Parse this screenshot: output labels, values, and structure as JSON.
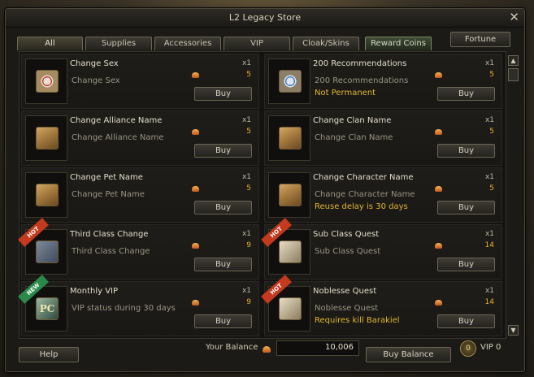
{
  "window": {
    "title": "L2 Legacy Store",
    "close_icon": "close-icon"
  },
  "tabs": [
    {
      "label": "All",
      "active": true
    },
    {
      "label": "Supplies"
    },
    {
      "label": "Accessories"
    },
    {
      "label": "VIP"
    },
    {
      "label": "Cloak/Skins"
    },
    {
      "label": "Reward Coins"
    }
  ],
  "fortune_label": "Fortune",
  "items": [
    {
      "name": "Change Sex",
      "qty": "x1",
      "desc": "Change Sex",
      "price": "5",
      "buy": "Buy",
      "icon": "red-scroll-icon"
    },
    {
      "name": "200 Recommendations",
      "qty": "x1",
      "desc": "200 Recommendations",
      "note": "Not Permanent",
      "price": "5",
      "buy": "Buy",
      "icon": "blue-scroll-icon"
    },
    {
      "name": "Change Alliance Name",
      "qty": "x1",
      "desc": "Change Alliance Name",
      "price": "5",
      "buy": "Buy",
      "icon": "parchment-icon"
    },
    {
      "name": "Change Clan Name",
      "qty": "x1",
      "desc": "Change Clan Name",
      "price": "5",
      "buy": "Buy",
      "icon": "parchment-icon"
    },
    {
      "name": "Change Pet Name",
      "qty": "x1",
      "desc": "Change Pet Name",
      "price": "5",
      "buy": "Buy",
      "icon": "parchment-icon"
    },
    {
      "name": "Change Character Name",
      "qty": "x1",
      "desc": "Change Character Name",
      "note": "Reuse delay is 30 days",
      "price": "5",
      "buy": "Buy",
      "icon": "parchment-icon"
    },
    {
      "name": "Third Class Change",
      "qty": "x1",
      "desc": "Third Class Change",
      "price": "9",
      "buy": "Buy",
      "icon": "rune-scroll-icon",
      "ribbon": "HOT"
    },
    {
      "name": "Sub Class Quest",
      "qty": "x1",
      "desc": "Sub Class Quest",
      "price": "14",
      "buy": "Buy",
      "icon": "map-scroll-icon",
      "ribbon": "HOT"
    },
    {
      "name": "Monthly VIP",
      "qty": "x1",
      "desc": "VIP status during 30 days",
      "price": "9",
      "buy": "Buy",
      "icon": "pc-icon",
      "icon_text": "PC",
      "ribbon": "NEW"
    },
    {
      "name": "Noblesse Quest",
      "qty": "x1",
      "desc": "Noblesse Quest",
      "note": "Requires kill Barakiel",
      "price": "14",
      "buy": "Buy",
      "icon": "map-scroll-icon",
      "ribbon": "HOT"
    }
  ],
  "footer": {
    "help": "Help",
    "balance_label": "Your Balance",
    "balance_value": "10,006",
    "buy_balance": "Buy Balance",
    "vip_level": "0",
    "vip_label": "VIP 0"
  }
}
